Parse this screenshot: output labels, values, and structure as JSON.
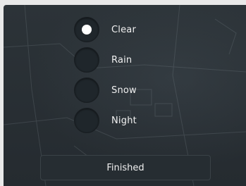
{
  "weather_options": [
    {
      "label": "Clear",
      "selected": true
    },
    {
      "label": "Rain",
      "selected": false
    },
    {
      "label": "Snow",
      "selected": false
    },
    {
      "label": "Night",
      "selected": false
    }
  ],
  "finish_button": {
    "label": "Finished"
  },
  "colors": {
    "panel": "#2a3136",
    "radio": "#1f262b",
    "selected_dot": "#ffffff",
    "text": "#f0f0f0"
  }
}
